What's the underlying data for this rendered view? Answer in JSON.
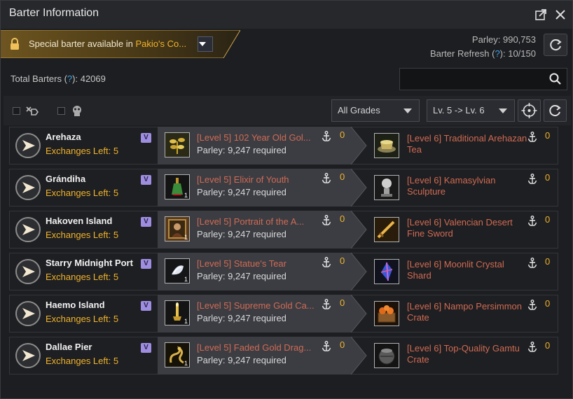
{
  "window": {
    "title": "Barter Information"
  },
  "banner": {
    "text_prefix": "Special barter available in ",
    "text_highlight": "Pakio's Co..."
  },
  "parley": {
    "label": "Parley: 990,753",
    "refresh_prefix": "Barter Refresh (",
    "refresh_q": "?",
    "refresh_suffix": "): 10/150"
  },
  "totals": {
    "prefix": "Total Barters (",
    "q": "?",
    "suffix": "): 42069"
  },
  "search": {
    "placeholder": ""
  },
  "filters": {
    "grade": "All Grades",
    "level": "Lv. 5 -> Lv. 6"
  },
  "rows": [
    {
      "location": "Arehaza",
      "exchanges": "Exchanges Left: 5",
      "badge": "V",
      "give_name": "[Level 5] 102 Year Old Gol...",
      "give_req": "Parley: 9,247 required",
      "give_anchor": "0",
      "give_count": "",
      "recv_name": "[Level 6] Traditional Arehazan Tea",
      "recv_anchor": "0",
      "give_icon": "golden-plant-icon",
      "recv_icon": "tea-cup-icon"
    },
    {
      "location": "Grándiha",
      "exchanges": "Exchanges Left: 5",
      "badge": "V",
      "give_name": "[Level 5] Elixir of Youth",
      "give_req": "Parley: 9,247 required",
      "give_anchor": "0",
      "give_count": "1",
      "recv_name": "[Level 6] Kamasylvian Sculpture",
      "recv_anchor": "0",
      "give_icon": "elixir-bottle-icon",
      "recv_icon": "sculpture-icon"
    },
    {
      "location": "Hakoven Island",
      "exchanges": "Exchanges Left: 5",
      "badge": "V",
      "give_name": "[Level 5] Portrait of the A...",
      "give_req": "Parley: 9,247 required",
      "give_anchor": "0",
      "give_count": "1",
      "recv_name": "[Level 6] Valencian Desert Fine Sword",
      "recv_anchor": "0",
      "give_icon": "portrait-icon",
      "recv_icon": "sword-icon"
    },
    {
      "location": "Starry Midnight Port",
      "exchanges": "Exchanges Left: 5",
      "badge": "V",
      "give_name": "[Level 5] Statue's Tear",
      "give_req": "Parley: 9,247 required",
      "give_anchor": "0",
      "give_count": "1",
      "recv_name": "[Level 6] Moonlit Crystal Shard",
      "recv_anchor": "0",
      "give_icon": "tear-gem-icon",
      "recv_icon": "crystal-shard-icon"
    },
    {
      "location": "Haemo Island",
      "exchanges": "Exchanges Left: 5",
      "badge": "V",
      "give_name": "[Level 5] Supreme Gold Ca...",
      "give_req": "Parley: 9,247 required",
      "give_anchor": "0",
      "give_count": "1",
      "recv_name": "[Level 6] Nampo Persimmon Crate",
      "recv_anchor": "0",
      "give_icon": "gold-candlestick-icon",
      "recv_icon": "persimmon-crate-icon"
    },
    {
      "location": "Dallae Pier",
      "exchanges": "Exchanges Left: 5",
      "badge": "V",
      "give_name": "[Level 5] Faded Gold Drag...",
      "give_req": "Parley: 9,247 required",
      "give_anchor": "0",
      "give_count": "1",
      "recv_name": "[Level 6] Top-Quality Gamtu Crate",
      "recv_anchor": "0",
      "give_icon": "gold-dragon-icon",
      "recv_icon": "gamtu-crate-icon"
    }
  ]
}
